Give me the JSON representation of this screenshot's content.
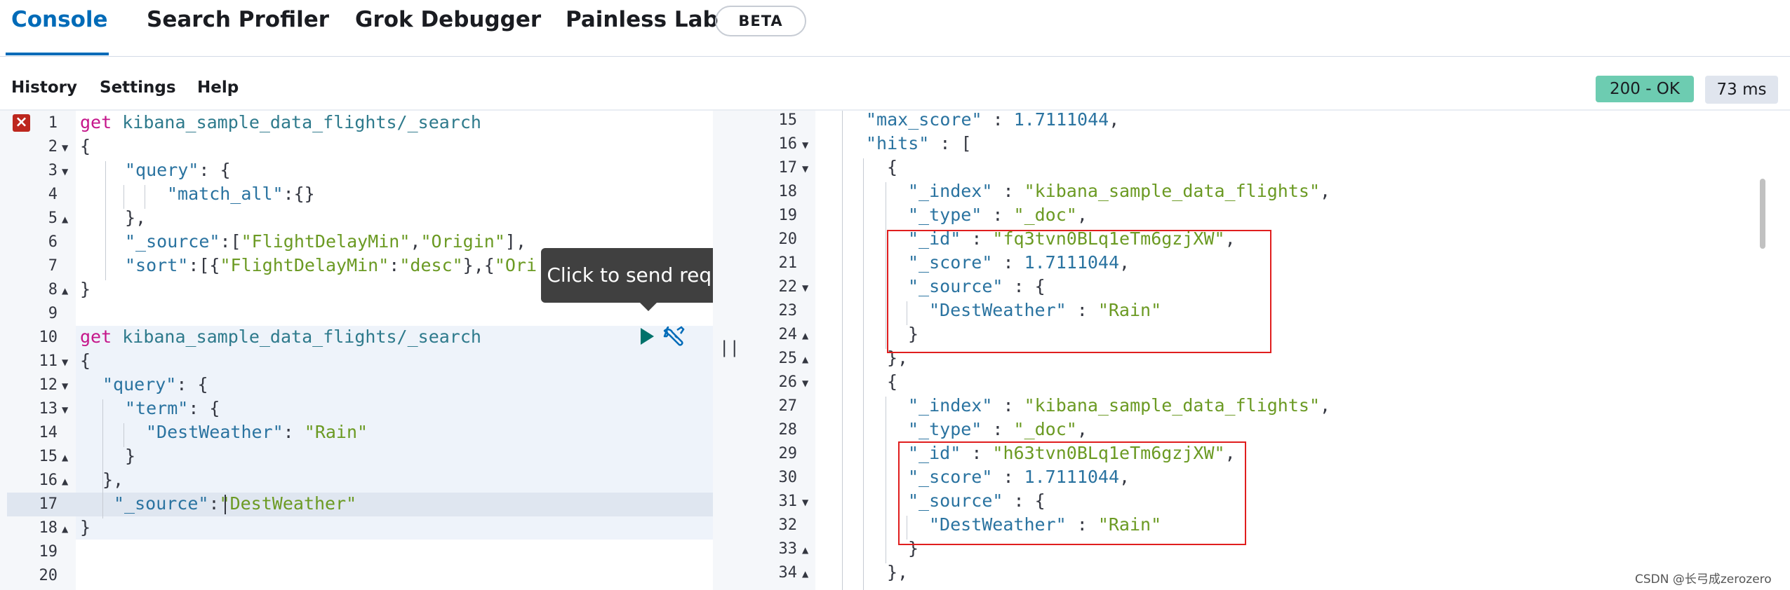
{
  "tabs": [
    {
      "label": "Console",
      "active": true
    },
    {
      "label": "Search Profiler",
      "active": false
    },
    {
      "label": "Grok Debugger",
      "active": false
    },
    {
      "label": "Painless Lab",
      "active": false
    }
  ],
  "beta_badge": "BETA",
  "menu": {
    "history": "History",
    "settings": "Settings",
    "help": "Help"
  },
  "status": {
    "code": "200 - OK",
    "time": "73 ms",
    "ok_color": "#6dccb1"
  },
  "request": {
    "line_numbers": [
      "1",
      "2",
      "3",
      "4",
      "5",
      "6",
      "7",
      "8",
      "9",
      "10",
      "11",
      "12",
      "13",
      "14",
      "15",
      "16",
      "17",
      "18",
      "19",
      "20"
    ],
    "l1": {
      "method": "get",
      "path": "kibana_sample_data_flights/_search"
    },
    "l2": "{",
    "l3": {
      "k": "\"query\"",
      "p": ": {"
    },
    "l4": {
      "k": "\"match_all\"",
      "p": ":{}"
    },
    "l5": "},",
    "l6": {
      "k": "\"_source\"",
      "p1": ":[",
      "s1": "\"FlightDelayMin\"",
      "p2": ",",
      "s2": "\"Origin\"",
      "p3": "],"
    },
    "l7": {
      "k": "\"sort\"",
      "p1": ":[{",
      "s1": "\"FlightDelayMin\"",
      "p2": ":",
      "s2": "\"desc\"",
      "p3": "},{",
      "s3": "\"Ori"
    },
    "l8": "}",
    "l10": {
      "method": "get",
      "path": "kibana_sample_data_flights/_search"
    },
    "l11": "{",
    "l12": {
      "k": "\"query\"",
      "p": ": {"
    },
    "l13": {
      "k": "\"term\"",
      "p": ": {"
    },
    "l14": {
      "k": "\"DestWeather\"",
      "p": ": ",
      "v": "\"Rain\""
    },
    "l15": "}",
    "l16": "},",
    "l17": {
      "k": "\"_source\"",
      "p": ":",
      "v": "\"DestWeather\""
    },
    "l18": "}"
  },
  "tooltip": "Click to send request",
  "response": {
    "line_numbers": [
      "15",
      "16",
      "17",
      "18",
      "19",
      "20",
      "21",
      "22",
      "23",
      "24",
      "25",
      "26",
      "27",
      "28",
      "29",
      "30",
      "31",
      "32",
      "33",
      "34"
    ],
    "r15": {
      "k": "\"max_score\"",
      "p": " : ",
      "v": "1.7111044",
      "e": ","
    },
    "r16": {
      "k": "\"hits\"",
      "p": " : ["
    },
    "r17": "{",
    "r18": {
      "k": "\"_index\"",
      "p": " : ",
      "v": "\"kibana_sample_data_flights\"",
      "e": ","
    },
    "r19": {
      "k": "\"_type\"",
      "p": " : ",
      "v": "\"_doc\"",
      "e": ","
    },
    "r20": {
      "k": "\"_id\"",
      "p": " : ",
      "v": "\"fq3tvn0BLq1eTm6gzjXW\"",
      "e": ","
    },
    "r21": {
      "k": "\"_score\"",
      "p": " : ",
      "v": "1.7111044",
      "e": ","
    },
    "r22": {
      "k": "\"_source\"",
      "p": " : {"
    },
    "r23": {
      "k": "\"DestWeather\"",
      "p": " : ",
      "v": "\"Rain\""
    },
    "r24": "}",
    "r25": "},",
    "r26": "{",
    "r27": {
      "k": "\"_index\"",
      "p": " : ",
      "v": "\"kibana_sample_data_flights\"",
      "e": ","
    },
    "r28": {
      "k": "\"_type\"",
      "p": " : ",
      "v": "\"_doc\"",
      "e": ","
    },
    "r29": {
      "k": "\"_id\"",
      "p": " : ",
      "v": "\"h63tvn0BLq1eTm6gzjXW\"",
      "e": ","
    },
    "r30": {
      "k": "\"_score\"",
      "p": " : ",
      "v": "1.7111044",
      "e": ","
    },
    "r31": {
      "k": "\"_source\"",
      "p": " : {"
    },
    "r32": {
      "k": "\"DestWeather\"",
      "p": " : ",
      "v": "\"Rain\""
    },
    "r33": "}",
    "r34": "},"
  },
  "watermark": "CSDN @长弓成zerozero"
}
